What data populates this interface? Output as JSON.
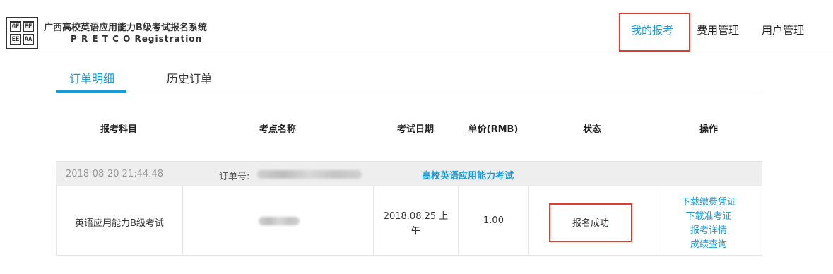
{
  "header": {
    "logo_letters": [
      "GE",
      "EE",
      "EE",
      "AA"
    ],
    "brand_cn": "广西高校英语应用能力B级考试报名系统",
    "brand_en": "P R E T C O Registration",
    "nav": [
      {
        "label": "我的报考",
        "active": true
      },
      {
        "label": "费用管理",
        "active": false
      },
      {
        "label": "用户管理",
        "active": false
      }
    ]
  },
  "tabs": [
    {
      "label": "订单明细",
      "active": true
    },
    {
      "label": "历史订单",
      "active": false
    }
  ],
  "table": {
    "headers": [
      "报考科目",
      "考点名称",
      "考试日期",
      "单价(RMB)",
      "状态",
      "操作"
    ],
    "order": {
      "time": "2018-08-20 21:44:48",
      "order_no_label": "订单号:",
      "exam_name": "高校英语应用能力考试"
    },
    "row": {
      "subject": "英语应用能力B级考试",
      "date_line1": "2018.08.25 上",
      "date_line2": "午",
      "price": "1.00",
      "status": "报名成功",
      "actions": [
        "下载缴费凭证",
        "下载准考证",
        "报考详情",
        "成绩查询"
      ]
    }
  },
  "colors": {
    "accent": "#1a9ad6",
    "highlight": "#e23b2e"
  }
}
